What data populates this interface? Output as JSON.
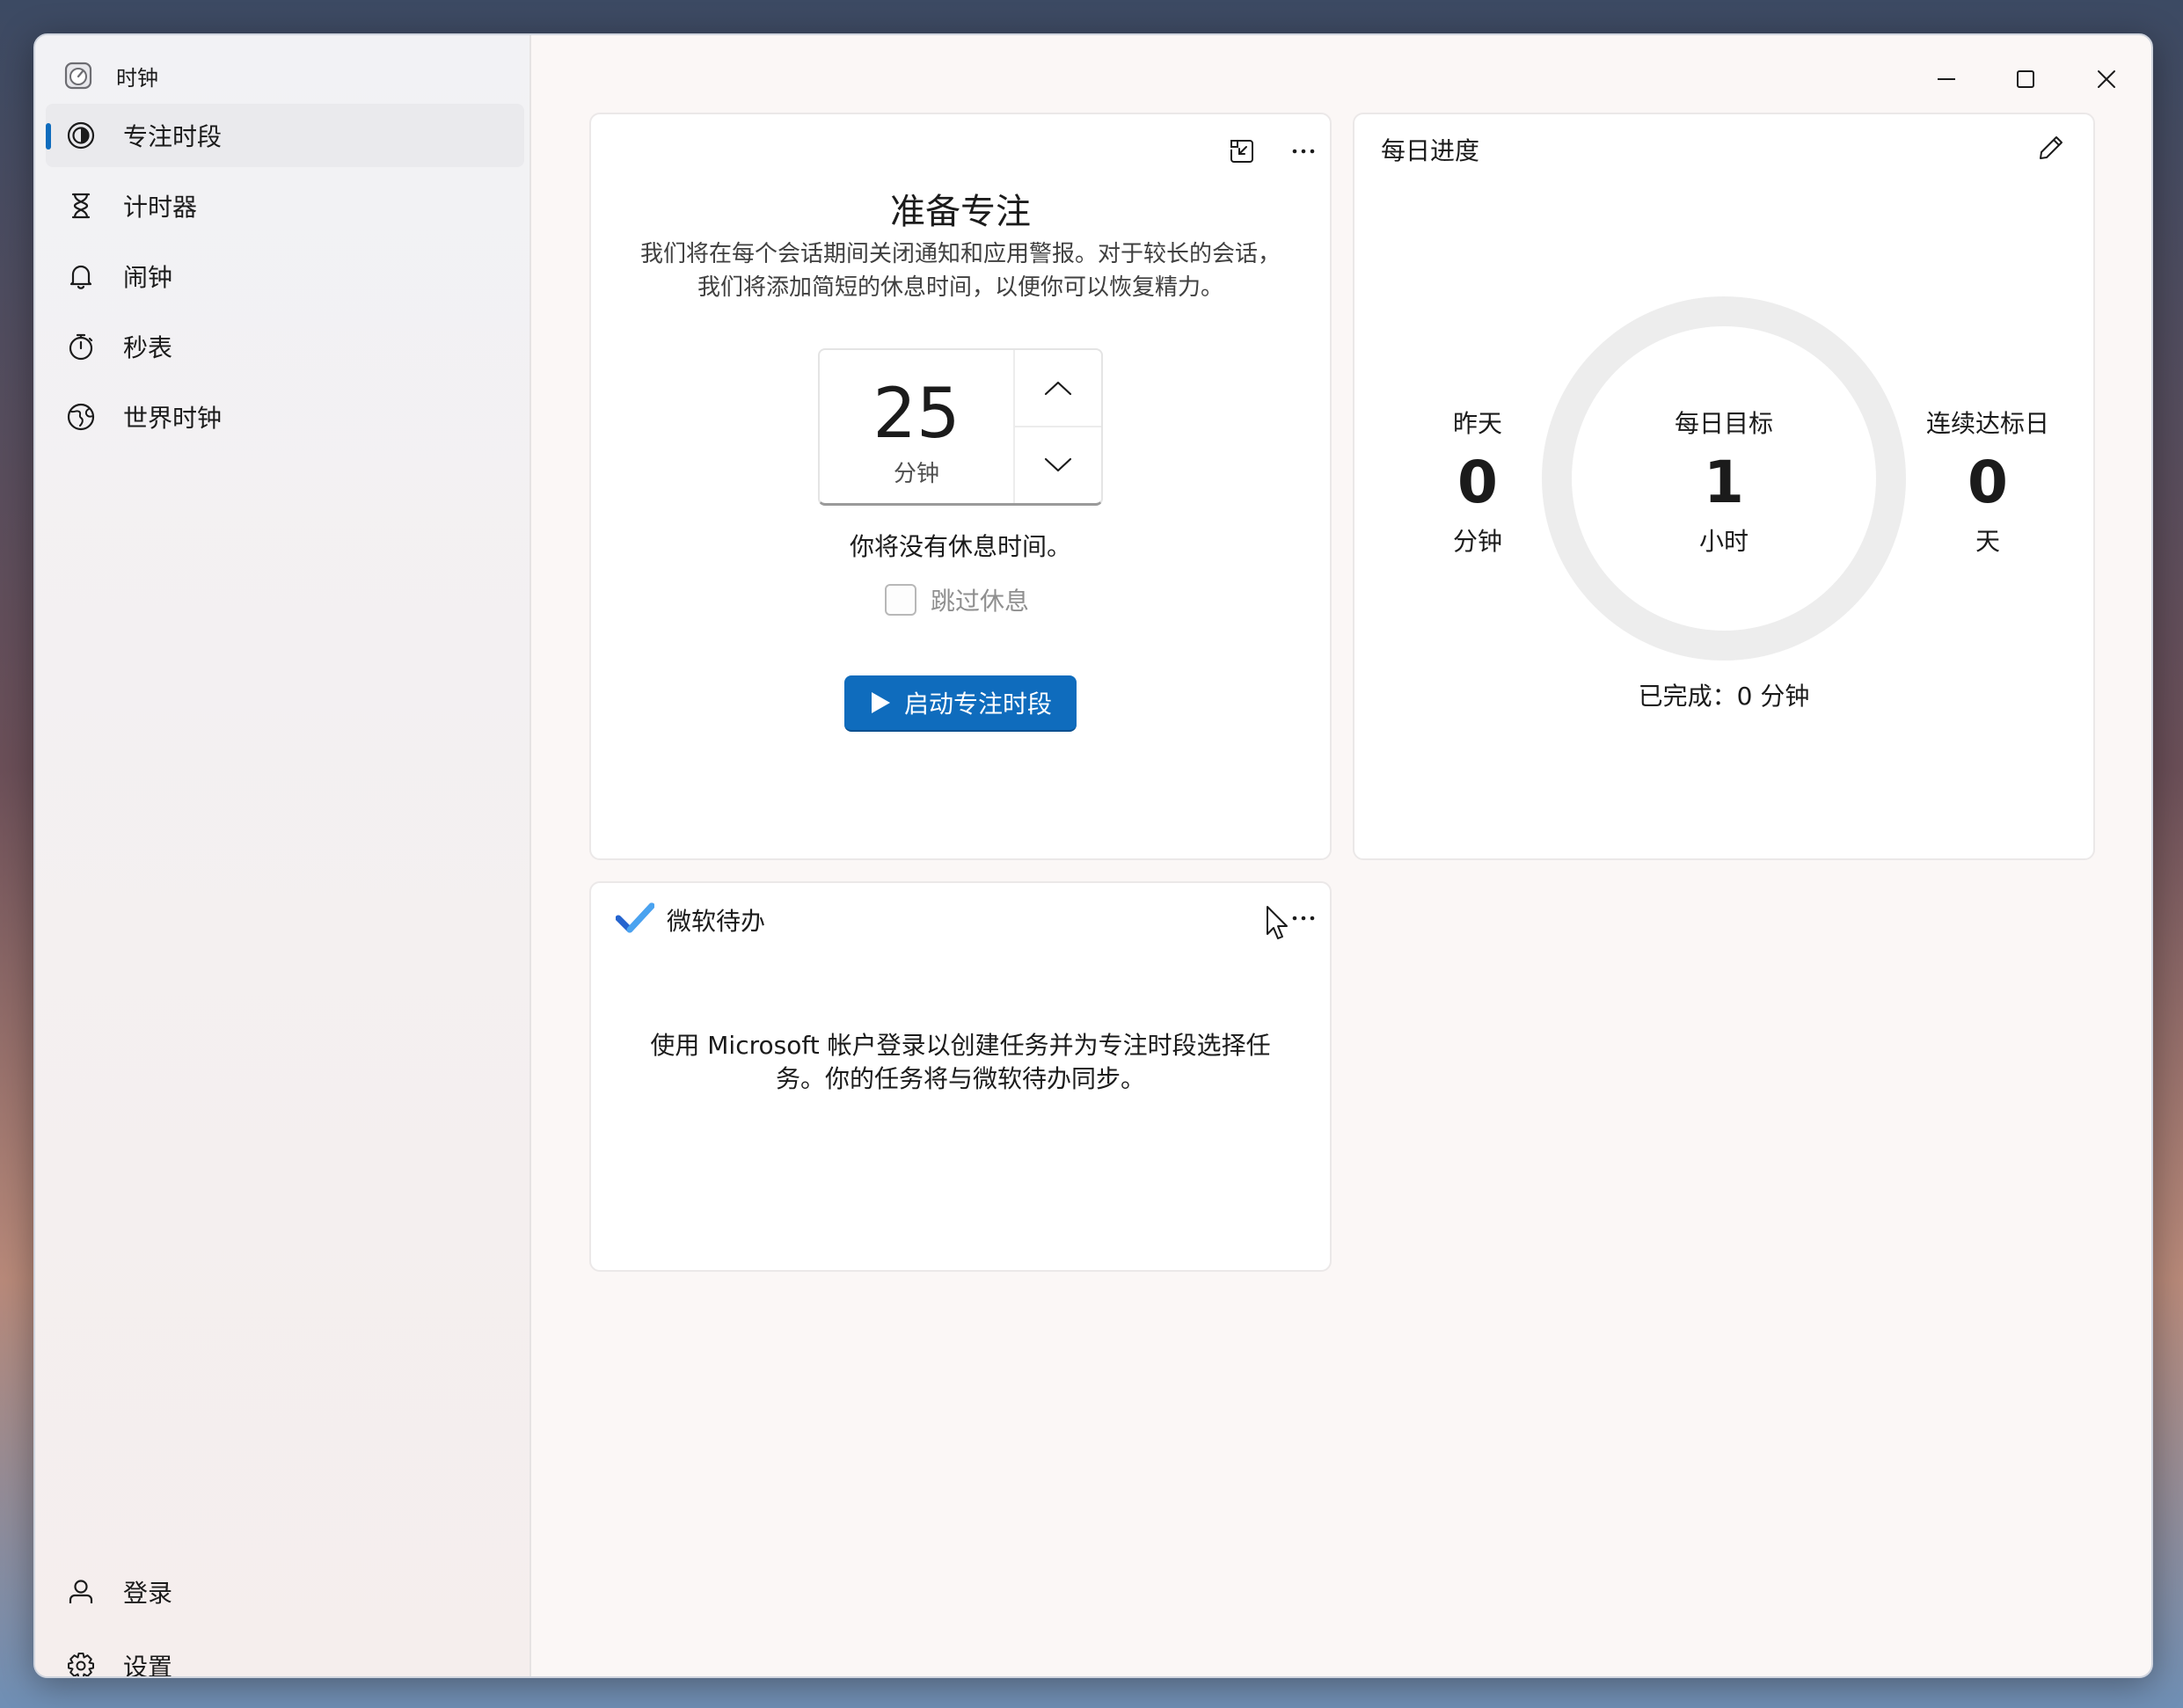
{
  "app": {
    "title": "时钟"
  },
  "sidebar": {
    "items": [
      {
        "label": "专注时段",
        "icon": "focus-icon",
        "active": true
      },
      {
        "label": "计时器",
        "icon": "hourglass-icon",
        "active": false
      },
      {
        "label": "闹钟",
        "icon": "bell-icon",
        "active": false
      },
      {
        "label": "秒表",
        "icon": "stopwatch-icon",
        "active": false
      },
      {
        "label": "世界时钟",
        "icon": "globe-icon",
        "active": false
      }
    ],
    "bottom": [
      {
        "label": "登录",
        "icon": "person-icon"
      },
      {
        "label": "设置",
        "icon": "gear-icon"
      }
    ]
  },
  "focus_card": {
    "heading": "准备专注",
    "description": "我们将在每个会话期间关闭通知和应用警报。对于较长的会话，我们将添加简短的休息时间，以便你可以恢复精力。",
    "duration_value": "25",
    "duration_unit": "分钟",
    "break_text": "你将没有休息时间。",
    "skip_break_label": "跳过休息",
    "skip_break_checked": false,
    "start_button": "启动专注时段"
  },
  "progress_card": {
    "title": "每日进度",
    "yesterday": {
      "label": "昨天",
      "value": "0",
      "unit": "分钟"
    },
    "goal": {
      "label": "每日目标",
      "value": "1",
      "unit": "小时"
    },
    "streak": {
      "label": "连续达标日",
      "value": "0",
      "unit": "天"
    },
    "completed_text": "已完成：0 分钟",
    "ring_fraction": 0
  },
  "todo_card": {
    "title": "微软待办",
    "description": "使用 Microsoft 帐户登录以创建任务并为专注时段选择任务。你的任务将与微软待办同步。"
  },
  "colors": {
    "accent": "#0f6cbd",
    "ring": "#ededed",
    "todo_check": "#2564cf"
  }
}
